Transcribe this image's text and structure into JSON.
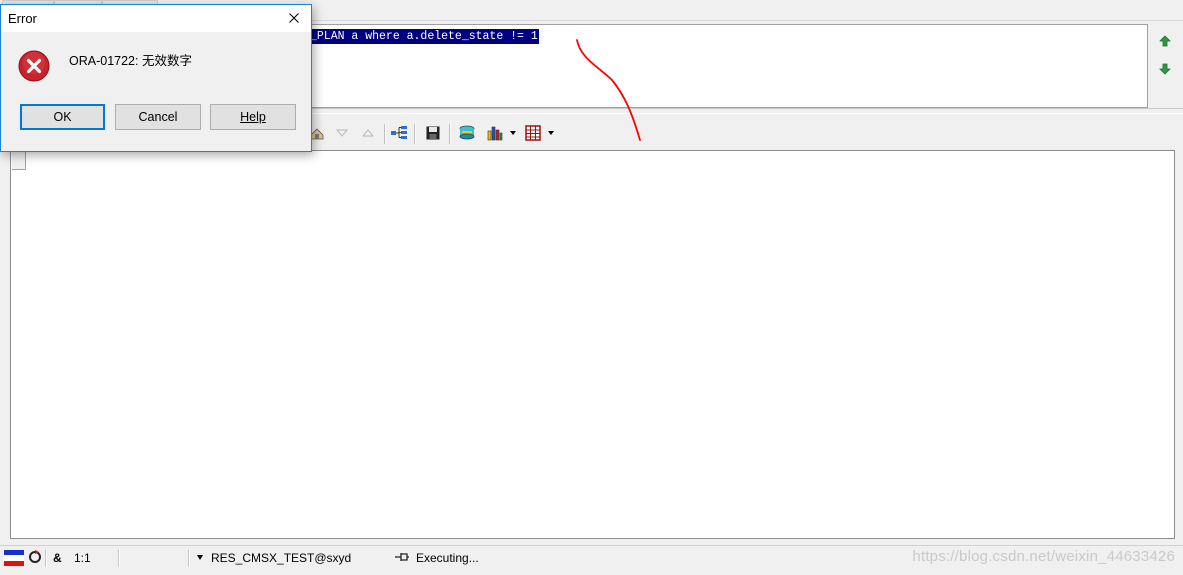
{
  "sql_editor": {
    "selected_text": "_PLAN a where a.delete_state != 1"
  },
  "nav": {
    "up_icon": "arrow-up-icon",
    "down_icon": "arrow-down-icon"
  },
  "toolbar": {
    "icons": [
      "fetch-all-icon",
      "previous-record-icon",
      "next-record-icon",
      "query-tree-icon",
      "save-icon",
      "export-icon",
      "chart-icon",
      "grid-layout-icon"
    ]
  },
  "dialog": {
    "title": "Error",
    "message": "ORA-01722: 无效数字",
    "ok_label": "OK",
    "cancel_label": "Cancel",
    "help_label": "Help",
    "icon": "error-icon"
  },
  "statusbar": {
    "ampersand": "&",
    "position": "1:1",
    "connection": "RES_CMSX_TEST@sxyd",
    "status": "Executing..."
  },
  "watermark": "https://blog.csdn.net/weixin_44633426",
  "colors": {
    "selection_bg": "#000080",
    "annotation_stroke": "#ff0000",
    "dialog_border": "#1883d7"
  }
}
